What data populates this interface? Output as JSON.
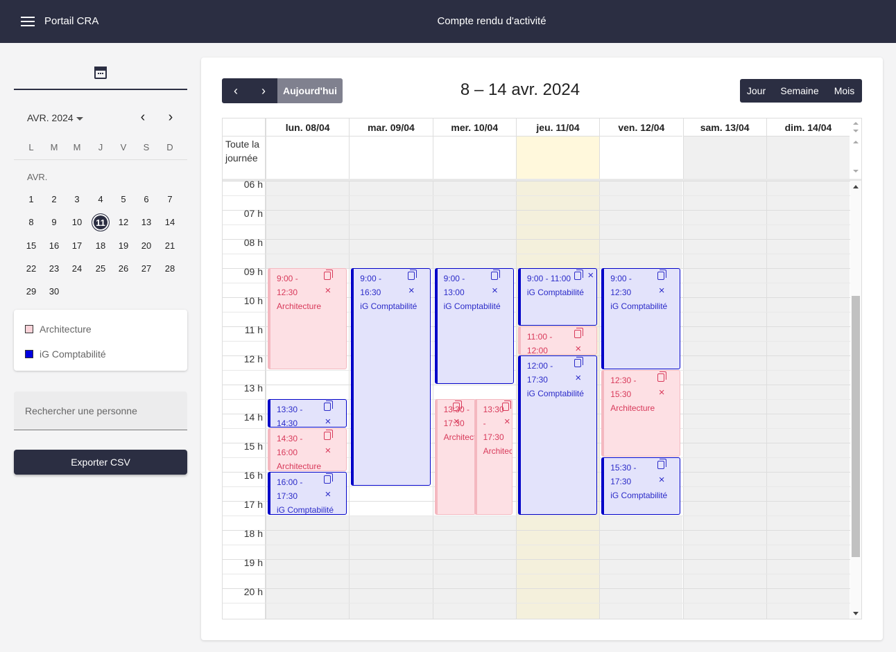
{
  "header": {
    "app_name": "Portail CRA",
    "title": "Compte rendu d'activité"
  },
  "sidebar": {
    "mini_calendar": {
      "month_label": "AVR. 2024",
      "weekdays": [
        "L",
        "M",
        "M",
        "J",
        "V",
        "S",
        "D"
      ],
      "section_label": "AVR.",
      "weeks": [
        [
          "1",
          "2",
          "3",
          "4",
          "5",
          "6",
          "7"
        ],
        [
          "8",
          "9",
          "10",
          "11",
          "12",
          "13",
          "14"
        ],
        [
          "15",
          "16",
          "17",
          "18",
          "19",
          "20",
          "21"
        ],
        [
          "22",
          "23",
          "24",
          "25",
          "26",
          "27",
          "28"
        ],
        [
          "29",
          "30"
        ]
      ],
      "today": "11"
    },
    "legend": [
      {
        "label": "Architecture",
        "color": "#fbd3d9"
      },
      {
        "label": "iG Comptabilité",
        "color": "#0000e0"
      }
    ],
    "search_placeholder": "Rechercher une personne",
    "export_label": "Exporter CSV"
  },
  "calendar": {
    "today_label": "Aujourd'hui",
    "prev_icon": "‹",
    "next_icon": "›",
    "range_title": "8 – 14 avr. 2024",
    "views": [
      "Jour",
      "Semaine",
      "Mois"
    ],
    "day_headers": [
      "lun. 08/04",
      "mar. 09/04",
      "mer. 10/04",
      "jeu. 11/04",
      "ven. 12/04",
      "sam. 13/04",
      "dim. 14/04"
    ],
    "allday_label": "Toute la journée",
    "hours": [
      "06 h",
      "07 h",
      "08 h",
      "09 h",
      "10 h",
      "11 h",
      "12 h",
      "13 h",
      "14 h",
      "15 h",
      "16 h",
      "17 h",
      "18 h",
      "19 h",
      "20 h"
    ],
    "colors": {
      "today_column": "#fff8dc",
      "weekend": "#f0f0f0",
      "arch": "#fde0e4",
      "igc": "#e3e3fb",
      "igc_border": "#0000c8"
    },
    "events": [
      {
        "day": 0,
        "start": "9:00",
        "end": "12:30",
        "type": "arch",
        "time_label": "9:00 -",
        "end_label": "12:30",
        "label": "Architecture"
      },
      {
        "day": 0,
        "start": "13:30",
        "end": "14:30",
        "type": "igc",
        "time_label": "13:30 -",
        "end_label": "14:30",
        "label": ""
      },
      {
        "day": 0,
        "start": "14:30",
        "end": "16:00",
        "type": "arch",
        "time_label": "14:30 -",
        "end_label": "16:00",
        "label": "Architecture"
      },
      {
        "day": 0,
        "start": "16:00",
        "end": "17:30",
        "type": "igc",
        "time_label": "16:00 -",
        "end_label": "17:30",
        "label": "iG Comptabilité"
      },
      {
        "day": 1,
        "start": "9:00",
        "end": "16:30",
        "type": "igc",
        "time_label": "9:00 -",
        "end_label": "16:30",
        "label": "iG Comptabilité"
      },
      {
        "day": 2,
        "start": "9:00",
        "end": "13:00",
        "type": "igc",
        "time_label": "9:00 -",
        "end_label": "13:00",
        "label": "iG Comptabilité"
      },
      {
        "day": 2,
        "start": "13:30",
        "end": "17:30",
        "type": "arch",
        "time_label": "13:30 -",
        "end_label": "17:30",
        "label": "Architect",
        "half": "left"
      },
      {
        "day": 2,
        "start": "13:30",
        "end": "17:30",
        "type": "arch",
        "time_label": "13:30",
        "end_label": "-",
        "extra_label": "17:30",
        "label": "Architect",
        "half": "right"
      },
      {
        "day": 3,
        "start": "9:00",
        "end": "11:00",
        "type": "igc",
        "time_label": "9:00 - 11:00",
        "end_label": "",
        "label": "iG Comptabilité"
      },
      {
        "day": 3,
        "start": "11:00",
        "end": "12:00",
        "type": "arch",
        "time_label": "11:00 -",
        "end_label": "12:00",
        "label": ""
      },
      {
        "day": 3,
        "start": "12:00",
        "end": "17:30",
        "type": "igc",
        "time_label": "12:00 -",
        "end_label": "17:30",
        "label": "iG Comptabilité"
      },
      {
        "day": 4,
        "start": "9:00",
        "end": "12:30",
        "type": "igc",
        "time_label": "9:00 -",
        "end_label": "12:30",
        "label": "iG Comptabilité"
      },
      {
        "day": 4,
        "start": "12:30",
        "end": "15:30",
        "type": "arch",
        "time_label": "12:30 -",
        "end_label": "15:30",
        "label": "Architecture"
      },
      {
        "day": 4,
        "start": "15:30",
        "end": "17:30",
        "type": "igc",
        "time_label": "15:30 -",
        "end_label": "17:30",
        "label": "iG Comptabilité"
      }
    ]
  }
}
